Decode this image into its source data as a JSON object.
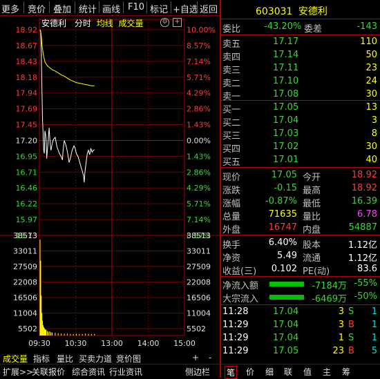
{
  "toolbar": {
    "items": [
      "更多",
      "竞价",
      "叠加",
      "统计",
      "画线",
      "F10",
      "标记",
      "+自选",
      "返回"
    ]
  },
  "chart_header": {
    "name": "安德利",
    "tabs": [
      "分时",
      "均线",
      "成交量"
    ]
  },
  "chart_data": {
    "type": "line",
    "price_ticks": [
      "18.92",
      "18.67",
      "18.43",
      "18.18",
      "17.94",
      "17.69",
      "17.45",
      "17.20",
      "16.95",
      "16.71",
      "16.46",
      "16.22",
      "15.97",
      "15.73"
    ],
    "pct_ticks": [
      "10.00%",
      "8.57%",
      "7.14%",
      "5.71%",
      "4.29%",
      "2.86%",
      "1.43%",
      "0.00%",
      "1.43%",
      "2.86%",
      "4.29%",
      "5.71%",
      "7.14%",
      "8.57%"
    ],
    "vol_ticks": [
      "38513",
      "33011",
      "27509",
      "22008",
      "16506",
      "11004",
      "5502"
    ],
    "time_ticks": [
      "09:30",
      "10:30",
      "13:00",
      "14:00",
      "15:00"
    ],
    "ylim": [
      15.73,
      18.92
    ],
    "prev_close": 17.2,
    "price_series": [
      [
        0,
        18.92
      ],
      [
        1,
        18.88
      ],
      [
        2,
        18.55
      ],
      [
        3,
        18.05
      ],
      [
        4,
        17.55
      ],
      [
        5,
        17.3
      ],
      [
        6,
        17.05
      ],
      [
        7,
        17.0
      ],
      [
        8,
        17.35
      ],
      [
        9,
        17.3
      ],
      [
        10,
        17.2
      ],
      [
        11,
        16.92
      ],
      [
        12,
        17.05
      ],
      [
        13,
        17.15
      ],
      [
        14,
        17.28
      ],
      [
        15,
        17.4
      ],
      [
        16,
        17.25
      ],
      [
        17,
        17.12
      ],
      [
        18,
        17.05
      ],
      [
        20,
        17.15
      ],
      [
        22,
        17.22
      ],
      [
        25,
        17.25
      ],
      [
        28,
        17.1
      ],
      [
        30,
        17.05
      ],
      [
        32,
        17.0
      ],
      [
        35,
        16.95
      ],
      [
        37,
        16.9
      ],
      [
        38,
        17.05
      ],
      [
        40,
        17.2
      ],
      [
        42,
        17.15
      ],
      [
        44,
        17.08
      ],
      [
        46,
        16.98
      ],
      [
        48,
        16.86
      ],
      [
        50,
        16.92
      ],
      [
        53,
        17.05
      ],
      [
        56,
        17.12
      ],
      [
        58,
        17.08
      ],
      [
        60,
        17.0
      ],
      [
        63,
        16.95
      ],
      [
        66,
        16.85
      ],
      [
        68,
        16.78
      ],
      [
        70,
        16.72
      ],
      [
        72,
        16.65
      ],
      [
        73,
        16.55
      ],
      [
        74,
        16.7
      ],
      [
        76,
        16.85
      ],
      [
        78,
        17.0
      ],
      [
        80,
        17.05
      ],
      [
        82,
        16.98
      ],
      [
        84,
        17.08
      ],
      [
        86,
        17.02
      ],
      [
        88,
        17.05
      ],
      [
        90,
        17.06
      ]
    ],
    "avg_series": [
      [
        0,
        18.92
      ],
      [
        1,
        18.9
      ],
      [
        2,
        18.82
      ],
      [
        3,
        18.7
      ],
      [
        5,
        18.55
      ],
      [
        8,
        18.42
      ],
      [
        12,
        18.36
      ],
      [
        16,
        18.33
      ],
      [
        20,
        18.3
      ],
      [
        25,
        18.28
      ],
      [
        30,
        18.25
      ],
      [
        35,
        18.22
      ],
      [
        40,
        18.2
      ],
      [
        45,
        18.17
      ],
      [
        50,
        18.14
      ],
      [
        55,
        18.12
      ],
      [
        60,
        18.1
      ],
      [
        65,
        18.09
      ],
      [
        70,
        18.08
      ],
      [
        75,
        18.07
      ],
      [
        80,
        18.06
      ],
      [
        85,
        18.05
      ],
      [
        90,
        18.05
      ]
    ],
    "volume_series": [
      [
        0,
        38513
      ],
      [
        1,
        30000
      ],
      [
        2,
        16000
      ],
      [
        3,
        9000
      ],
      [
        4,
        6000
      ],
      [
        5,
        4200
      ],
      [
        6,
        3500
      ],
      [
        7,
        3000
      ],
      [
        8,
        2600
      ],
      [
        9,
        2200
      ],
      [
        10,
        2400
      ],
      [
        12,
        1800
      ],
      [
        14,
        1500
      ],
      [
        16,
        1700
      ],
      [
        18,
        1300
      ],
      [
        20,
        1200
      ],
      [
        25,
        1100
      ],
      [
        30,
        900
      ],
      [
        35,
        800
      ],
      [
        40,
        700
      ],
      [
        45,
        750
      ],
      [
        50,
        650
      ],
      [
        55,
        600
      ],
      [
        60,
        700
      ],
      [
        65,
        650
      ],
      [
        70,
        600
      ],
      [
        75,
        800
      ],
      [
        80,
        700
      ],
      [
        85,
        600
      ],
      [
        90,
        650
      ]
    ]
  },
  "bottom_tabs": [
    "成交量",
    "指标",
    "量比",
    "买卖力道",
    "竞价图",
    "+",
    "-"
  ],
  "bottom_bar": [
    "扩展>>",
    "关联报价",
    "综合资讯",
    "行业资讯",
    "侧边栏",
    "笔",
    "价",
    "细",
    "联",
    "值",
    "主",
    "筹"
  ],
  "stock": {
    "code": "603031",
    "name": "安德利"
  },
  "weibi": {
    "label": "委比",
    "value": "-43.20%",
    "diff_label": "委差",
    "diff_value": "-143"
  },
  "sell": [
    {
      "label": "卖五",
      "price": "17.17",
      "vol": "110"
    },
    {
      "label": "卖四",
      "price": "17.14",
      "vol": "50"
    },
    {
      "label": "卖三",
      "price": "17.11",
      "vol": "23"
    },
    {
      "label": "卖二",
      "price": "17.10",
      "vol": "24"
    },
    {
      "label": "卖一",
      "price": "17.08",
      "vol": "30"
    }
  ],
  "buy": [
    {
      "label": "买一",
      "price": "17.05",
      "vol": "13"
    },
    {
      "label": "买二",
      "price": "17.04",
      "vol": "3"
    },
    {
      "label": "买三",
      "price": "17.03",
      "vol": "8"
    },
    {
      "label": "买四",
      "price": "17.02",
      "vol": "30"
    },
    {
      "label": "买五",
      "price": "17.01",
      "vol": "40"
    }
  ],
  "quote": [
    {
      "l1": "现价",
      "v1": "17.05",
      "l2": "今开",
      "v2": "18.92"
    },
    {
      "l1": "涨跌",
      "v1": "-0.15",
      "l2": "最高",
      "v2": "18.92"
    },
    {
      "l1": "涨幅",
      "v1": "-0.87%",
      "l2": "最低",
      "v2": "16.39"
    },
    {
      "l1": "总量",
      "v1": "71635",
      "l2": "量比",
      "v2": "6.78"
    },
    {
      "l1": "外盘",
      "v1": "16747",
      "l2": "内盘",
      "v2": "54887"
    }
  ],
  "stats": [
    {
      "l1": "换手",
      "v1": "6.40%",
      "l2": "股本",
      "v2": "1.12亿"
    },
    {
      "l1": "净资",
      "v1": "5.49",
      "l2": "流通",
      "v2": "1.12亿"
    },
    {
      "l1": "收益(三)",
      "v1": "0.102",
      "l2": "PE(动)",
      "v2": "83.6"
    }
  ],
  "flow": [
    {
      "label": "净流入额",
      "value": "-7184万",
      "pct": "-55%"
    },
    {
      "label": "大宗流入",
      "value": "-6469万",
      "pct": "-50%"
    }
  ],
  "ticks": [
    {
      "time": "11:28",
      "price": "17.04",
      "vol": "3",
      "side": "S",
      "count": "1"
    },
    {
      "time": "11:29",
      "price": "17.04",
      "vol": "3",
      "side": "B",
      "count": "1"
    },
    {
      "time": "11:29",
      "price": "17.04",
      "vol": "1",
      "side": "S",
      "count": "1"
    },
    {
      "time": "11:29",
      "price": "17.05",
      "vol": "23",
      "side": "B",
      "count": "5"
    }
  ]
}
